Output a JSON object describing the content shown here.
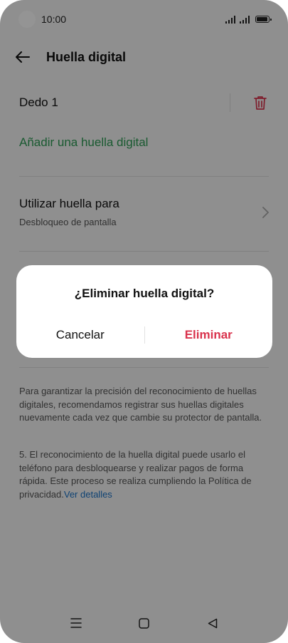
{
  "status_bar": {
    "time": "10:00"
  },
  "header": {
    "title": "Huella digital"
  },
  "fingerprint": {
    "name": "Dedo 1"
  },
  "add_fingerprint": {
    "label": "Añadir una huella digital"
  },
  "use_for": {
    "title": "Utilizar huella para",
    "subtitle": "Desbloqueo de pantalla"
  },
  "info": {
    "paragraph1": "Para garantizar la precisión del reconocimiento de huellas digitales, recomendamos registrar sus huellas digitales nuevamente cada vez que cambie su protector de pantalla.",
    "paragraph2": "5. El reconocimiento de la huella digital puede usarlo el teléfono para desbloquearse y realizar pagos de forma rápida. Este proceso se realiza cumpliendo la Política de privacidad.",
    "details_link": "Ver detalles"
  },
  "dialog": {
    "title": "¿Eliminar huella digital?",
    "cancel_label": "Cancelar",
    "confirm_label": "Eliminar"
  },
  "colors": {
    "accent_green": "#2e9b55",
    "danger_red": "#d9334d",
    "link_blue": "#1a73c7"
  },
  "icons": [
    "back-arrow-icon",
    "trash-icon",
    "chevron-right-icon",
    "menu-icon",
    "home-icon",
    "back-triangle-icon",
    "signal-icon",
    "battery-icon"
  ]
}
